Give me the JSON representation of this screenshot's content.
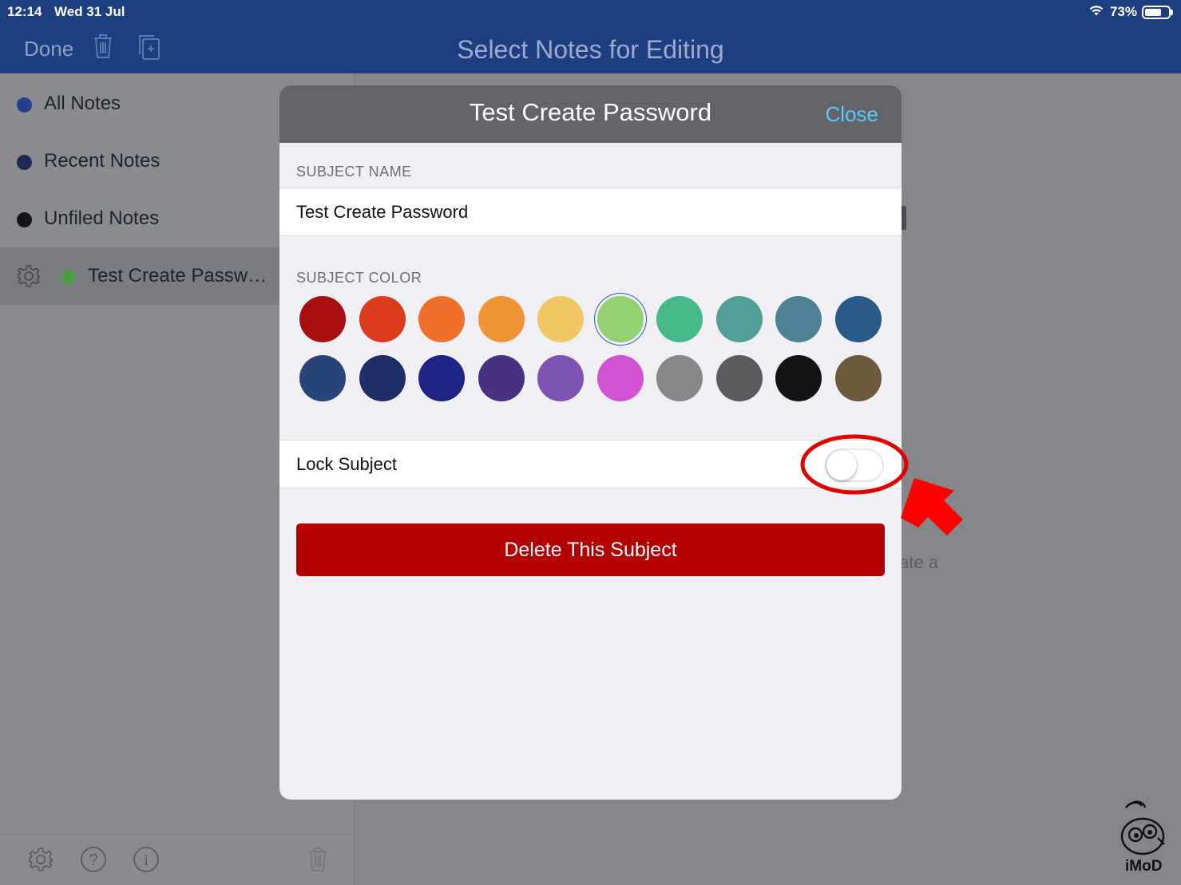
{
  "status": {
    "time": "12:14",
    "date": "Wed 31 Jul",
    "battery": "73%",
    "battery_level": 0.73
  },
  "nav": {
    "done_label": "Done",
    "title": "Select Notes for Editing"
  },
  "sidebar": {
    "items": [
      {
        "label": "All Notes",
        "color": "#233f8e"
      },
      {
        "label": "Recent Notes",
        "color": "#1b2a4f"
      },
      {
        "label": "Unfiled Notes",
        "color": "#151515"
      },
      {
        "label": "Test Create Passw…",
        "color": "#4f9a45"
      }
    ]
  },
  "main": {
    "hint_fragment": "ate a"
  },
  "modal": {
    "title": "Test Create Password",
    "close_label": "Close",
    "subject_name_label": "SUBJECT NAME",
    "subject_name_value": "Test Create Password",
    "subject_color_label": "SUBJECT COLOR",
    "colors": [
      "#a80f0e",
      "#dc3b1d",
      "#ef6f2b",
      "#ee9636",
      "#f1c766",
      "#92d072",
      "#46b988",
      "#539e97",
      "#4e8193",
      "#295b88",
      "#294479",
      "#1f2e66",
      "#1f2585",
      "#48327f",
      "#7d53b3",
      "#d152d3",
      "#878787",
      "#5b5b5d",
      "#141414",
      "#6b5a3b"
    ],
    "selected_color_index": 5,
    "lock_label": "Lock Subject",
    "lock_on": false,
    "delete_label": "Delete This Subject"
  },
  "watermark": {
    "text": "iMoD"
  }
}
